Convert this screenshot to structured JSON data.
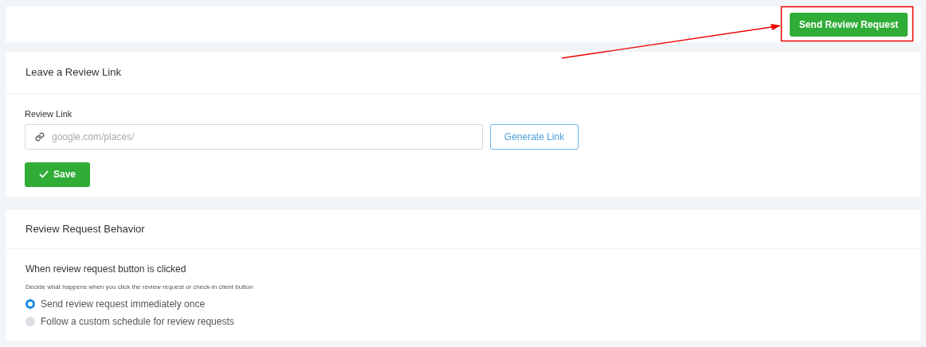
{
  "top_bar": {
    "button": {
      "label": "Send Review Request",
      "annotated": true
    }
  },
  "review_link_card": {
    "title": "Leave a Review Link",
    "field_label": "Review Link",
    "field_placeholder": "google.com/places/",
    "generate_button": "Generate Link",
    "save_button": "Save"
  },
  "behavior_card": {
    "title": "Review Request Behavior",
    "question": "When review request button is clicked",
    "hint": "Decide what happens when you click the review request or check-in client button",
    "options": [
      {
        "label": "Send review request immediately once",
        "selected": true
      },
      {
        "label": "Follow a custom schedule for review requests",
        "selected": false
      }
    ]
  }
}
